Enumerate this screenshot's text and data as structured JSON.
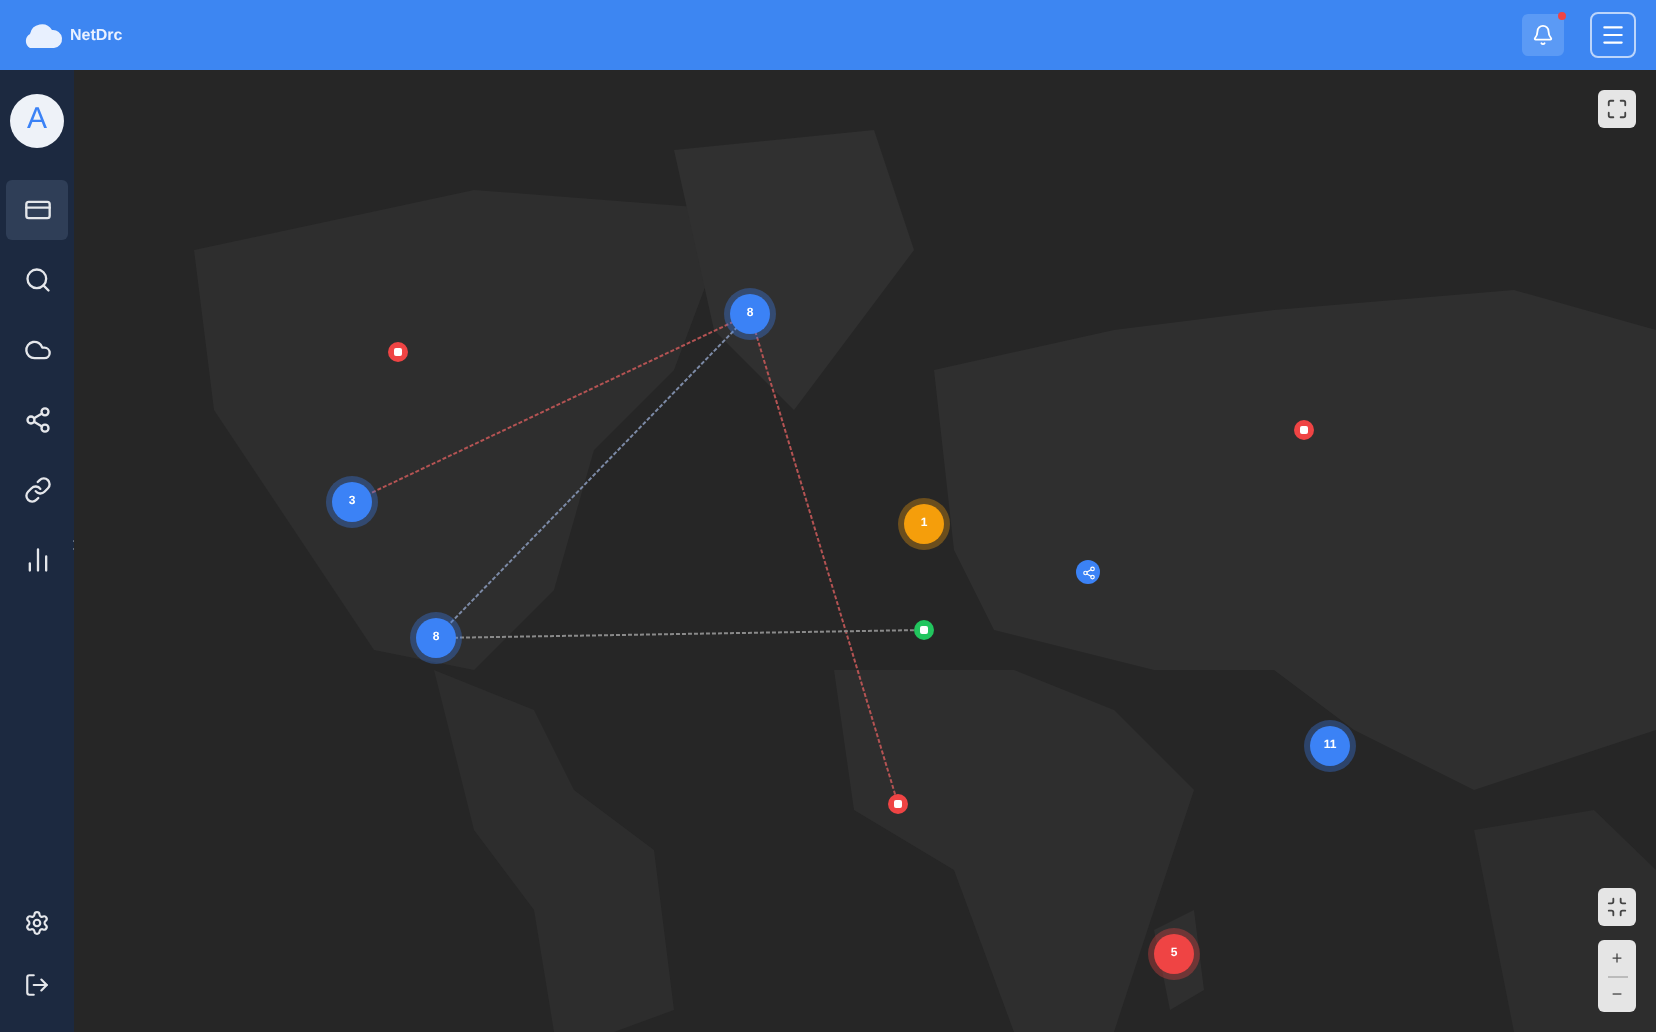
{
  "header": {
    "logo_text": "NetDrc",
    "notifications": {
      "unread": true
    }
  },
  "sidebar": {
    "avatar": "A",
    "items": [
      {
        "kind": "card",
        "selected": true
      },
      {
        "kind": "search",
        "selected": false
      },
      {
        "kind": "cloud",
        "selected": false
      },
      {
        "kind": "share",
        "selected": false
      },
      {
        "kind": "link",
        "selected": false
      },
      {
        "kind": "chart",
        "selected": false
      }
    ],
    "bottom_items": [
      {
        "kind": "settings"
      },
      {
        "kind": "logout"
      }
    ]
  },
  "map": {
    "markers": [
      {
        "kind": "cluster",
        "label": "8",
        "color": "#3b82f6"
      },
      {
        "kind": "cluster",
        "label": "3",
        "color": "#3b82f6"
      },
      {
        "kind": "cluster",
        "label": "8",
        "color": "#3b82f6"
      },
      {
        "kind": "cluster",
        "label": "1",
        "color": "#f59e0b"
      },
      {
        "kind": "cluster",
        "label": "11",
        "color": "#3b82f6"
      },
      {
        "kind": "cluster",
        "label": "5",
        "color": "#ef4444"
      },
      {
        "kind": "pin",
        "color": "#ef4444"
      },
      {
        "kind": "pin",
        "color": "#ef4444"
      },
      {
        "kind": "pin",
        "color": "#ef4444"
      },
      {
        "kind": "pin",
        "color": "#22c55e"
      },
      {
        "kind": "node",
        "color": "#3b82f6"
      }
    ],
    "links": [
      {
        "color": "#b45353"
      },
      {
        "color": "#7c8aa6"
      },
      {
        "color": "#b45353"
      },
      {
        "color": "#8a8a8a"
      }
    ],
    "zoom_in": "+",
    "zoom_out": "−"
  }
}
